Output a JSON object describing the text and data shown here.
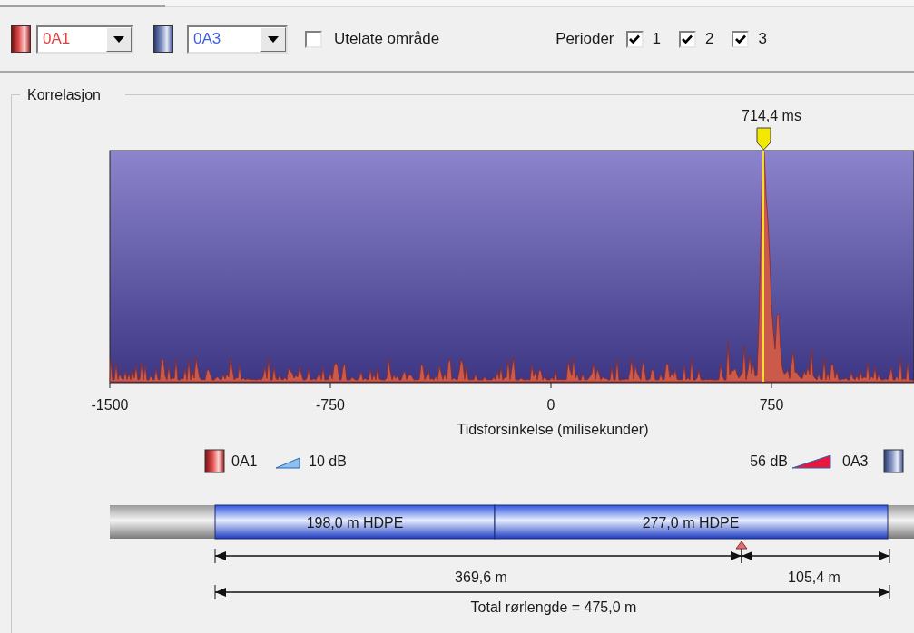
{
  "toolbar": {
    "sensor_a": {
      "value": "0A1"
    },
    "sensor_b": {
      "value": "0A3"
    },
    "exclude_area": {
      "label": "Utelate område",
      "checked": false
    },
    "periods": {
      "label": "Perioder",
      "items": [
        {
          "label": "1",
          "checked": true
        },
        {
          "label": "2",
          "checked": true
        },
        {
          "label": "3",
          "checked": true
        }
      ]
    }
  },
  "correlation": {
    "title": "Korrelasjon",
    "peak_marker": "714,4 ms",
    "x_ticks": [
      "-1500",
      "-750",
      "0",
      "750"
    ],
    "x_axis_title": "Tidsforsinkelse (milisekunder)",
    "legend": {
      "left": {
        "sensor": "0A1",
        "gain": "10 dB"
      },
      "right": {
        "gain": "56 dB",
        "sensor": "0A3"
      }
    },
    "pipe": {
      "segments": [
        {
          "label": "198,0 m HDPE"
        },
        {
          "label": "277,0 m HDPE"
        }
      ],
      "distance_left": "369,6 m",
      "distance_right": "105,4 m",
      "total": "Total rørlengde = 475,0 m"
    }
  }
}
